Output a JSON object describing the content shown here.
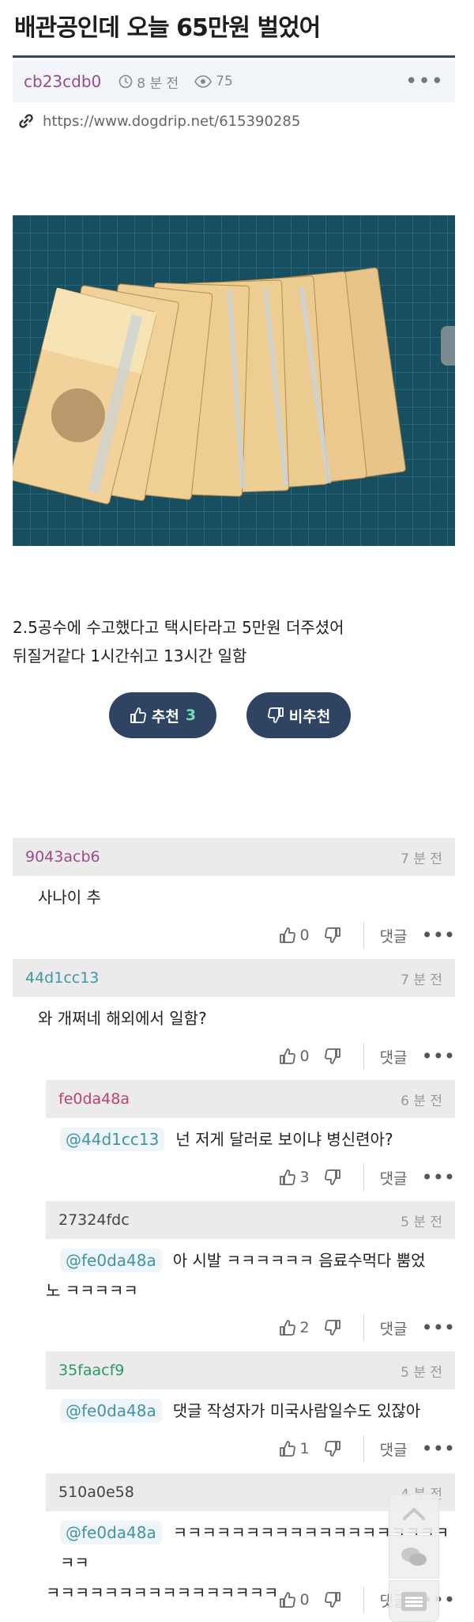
{
  "post": {
    "title": "배관공인데 오늘 65만원 벌었어",
    "author": "cb23cdb0",
    "time": "8 분 전",
    "views": "75",
    "more": "•••",
    "url": "https://www.dogdrip.net/615390285",
    "body_line1": "2.5공수에 수고했다고 택시타라고 5만원 더주셨어",
    "body_line2": "뒤질거같다 1시간쉬고 13시간 일함",
    "upvote_label": "추천",
    "upvote_count": "3",
    "downvote_label": "비추천"
  },
  "comment_ui": {
    "reply_label": "댓글",
    "more": "•••"
  },
  "comments": [
    {
      "author": "9043acb6",
      "author_color": "#9c4b8f",
      "time": "7 분 전",
      "mention": "",
      "text": "사나이 추",
      "text2": "",
      "likes": "0"
    },
    {
      "author": "44d1cc13",
      "author_color": "#3f96a7",
      "time": "7 분 전",
      "mention": "",
      "text": "와 개쩌네 해외에서 일함?",
      "text2": "",
      "likes": "0"
    },
    {
      "author": "fe0da48a",
      "author_color": "#c1416d",
      "time": "6 분 전",
      "mention": "@44d1cc13",
      "text": "넌 저게 달러로 보이냐 병신련아?",
      "text2": "",
      "likes": "3"
    },
    {
      "author": "27324fdc",
      "author_color": "#444444",
      "time": "5 분 전",
      "mention": "@fe0da48a",
      "text": "아 시발 ㅋㅋㅋㅋㅋㅋ 음료수먹다 뿜었",
      "text2": "노 ㅋㅋㅋㅋㅋ",
      "likes": "2"
    },
    {
      "author": "35faacf9",
      "author_color": "#2e9a63",
      "time": "5 분 전",
      "mention": "@fe0da48a",
      "text": "댓글 작성자가 미국사람일수도 있잖아",
      "text2": "",
      "likes": "1"
    },
    {
      "author": "510a0e58",
      "author_color": "#444444",
      "time": "4 분 전",
      "mention": "@fe0da48a",
      "text": "ㅋㅋㅋㅋㅋㅋㅋㅋㅋㅋㅋㅋㅋㅋㅋㅋㅋㅋㅋㅋㅋ",
      "text2": "ㅋㅋㅋㅋㅋㅋㅋㅋㅋㅋㅋㅋㅋㅋㅋㅋ",
      "likes": "0"
    }
  ],
  "colors": {
    "accent_navy": "#2f4463",
    "title_rule": "#32465e",
    "upvote_count": "#6fe0b4",
    "mention_text": "#3f96a7"
  }
}
